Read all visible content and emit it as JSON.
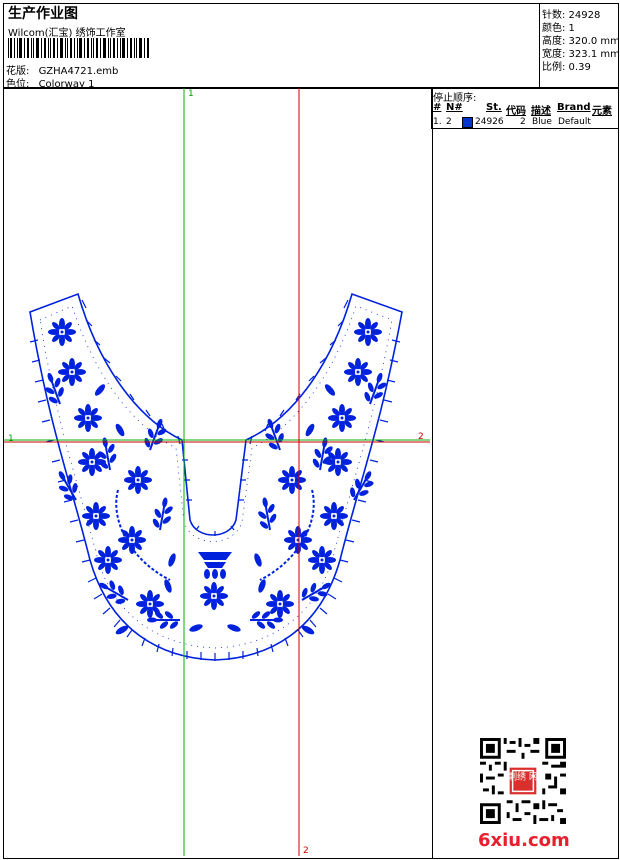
{
  "header": {
    "title": "生产作业图",
    "subtitle": "Wilcom(汇宝) 绣饰工作室",
    "design_label": "花版:",
    "design_value": "GZHA4721.emb",
    "colorway_label": "色位:",
    "colorway_value": "Colorway 1"
  },
  "stats": {
    "stitches": "针数: 24928",
    "colors": "颜色: 1",
    "height": "高度: 320.0 mm",
    "width": "宽度: 323.1 mm",
    "scale": "比例: 0.39"
  },
  "stop_sequence": {
    "title": "停止顺序:",
    "headers": [
      "#",
      "N#",
      "St.",
      "代码",
      "描述",
      "Brand",
      "元素"
    ],
    "rows": [
      {
        "index": "1.",
        "needle": "2",
        "stitches": "24926",
        "code": "2",
        "description": "Blue",
        "brand": "Default",
        "color": "#0033cc"
      }
    ]
  },
  "guides": {
    "v1_top": "1",
    "h1_left": "1",
    "h2_right": "2",
    "v2_bottom": "2"
  },
  "colors": {
    "thread": "#0022dd",
    "guide_green": "#00b000",
    "guide_red": "#cc0000",
    "frame": "#000000"
  },
  "watermark": {
    "text": "6xiu.com",
    "qr_center_text": "刺绣 网"
  }
}
